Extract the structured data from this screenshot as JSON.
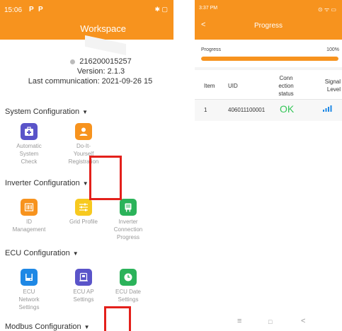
{
  "left": {
    "status_time": "15:06",
    "status_p1": "P",
    "status_p2": "P",
    "status_icons": "✱ ▢",
    "title": "Workspace",
    "serial": "216200015257",
    "version": "Version: 2.1.3",
    "last_comm": "Last communication: 2021-09-26 15",
    "sections": [
      {
        "title": "System Configuration",
        "items": [
          {
            "label": "Automatic System Check",
            "icon": "medical-kit-icon",
            "color": "#5a54c9"
          },
          {
            "label": "Do-It-Yourself Registration",
            "icon": "user-icon",
            "color": "#f7931e"
          }
        ]
      },
      {
        "title": "Inverter Configuration",
        "items": [
          {
            "label": "ID Management",
            "icon": "barcode-icon",
            "color": "#f7931e"
          },
          {
            "label": "Grid Profile",
            "icon": "sliders-icon",
            "color": "#f7c91f"
          },
          {
            "label": "Inverter Connection Progress",
            "icon": "inverter-icon",
            "color": "#2bb35a"
          }
        ]
      },
      {
        "title": "ECU Configuration",
        "items": [
          {
            "label": "ECU Network Settings",
            "icon": "network-icon",
            "color": "#1e88e5"
          },
          {
            "label": "ECU AP Settings",
            "icon": "router-icon",
            "color": "#5a54c9"
          },
          {
            "label": "ECU Date Settings",
            "icon": "clock-icon",
            "color": "#2bb35a"
          }
        ]
      },
      {
        "title": "Modbus Configuration"
      }
    ],
    "caret": "▼"
  },
  "right": {
    "status_time": "3:37 PM",
    "status_icons": "⊙ ᯤ ▭",
    "back_icon": "<",
    "title": "Progress",
    "progress_label": "Progress",
    "progress_value": "100%",
    "progress_fraction": 1.0,
    "table": {
      "headers": {
        "item": "Item",
        "uid": "UID",
        "conn": [
          "Conn",
          "ection",
          "status"
        ],
        "signal": [
          "Signal",
          "Level"
        ]
      },
      "rows": [
        {
          "item": "1",
          "uid": "406011100001",
          "status": "OK",
          "signal_level": 4
        }
      ]
    },
    "nav": {
      "menu": "≡",
      "home": "□",
      "back": "<"
    },
    "ok_color": "#35c759",
    "signal_color": "#1e88e5"
  },
  "accent": "#f7931e",
  "highlight_color": "#e3201b"
}
